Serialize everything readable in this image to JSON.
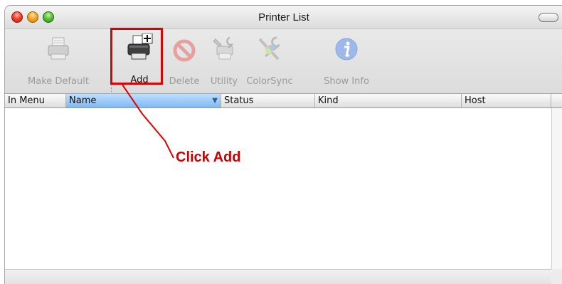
{
  "window": {
    "title": "Printer List"
  },
  "toolbar": {
    "items": [
      {
        "label": "Make Default",
        "icon": "printer-icon",
        "enabled": false
      },
      {
        "label": "Add",
        "icon": "printer-add-icon",
        "enabled": true
      },
      {
        "label": "Delete",
        "icon": "delete-icon",
        "enabled": false
      },
      {
        "label": "Utility",
        "icon": "utility-icon",
        "enabled": false
      },
      {
        "label": "ColorSync",
        "icon": "colorsync-icon",
        "enabled": false
      },
      {
        "label": "Show Info",
        "icon": "info-icon",
        "enabled": false
      }
    ]
  },
  "table": {
    "columns": [
      "In Menu",
      "Name",
      "Status",
      "Kind",
      "Host"
    ],
    "sorted_column": "Name",
    "sort_indicator": "▼",
    "rows": []
  },
  "annotation": {
    "text": "Click Add",
    "color": "#cc0000"
  },
  "colors": {
    "highlight": "#e00000",
    "selected_header": "#7fb8f3"
  }
}
